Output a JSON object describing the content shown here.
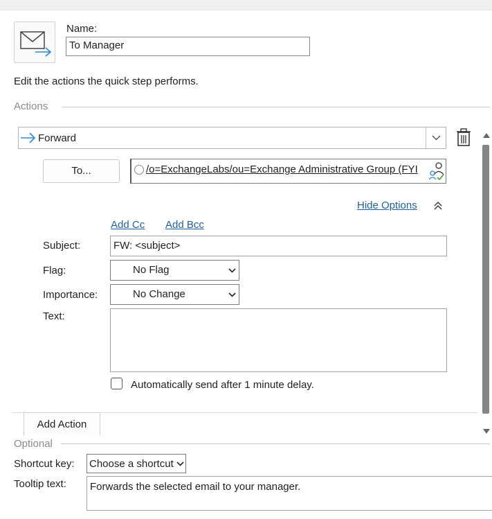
{
  "name": {
    "label": "Name:",
    "value": "To Manager"
  },
  "instructions": "Edit the actions the quick step performs.",
  "actions": {
    "section_label": "Actions",
    "action_select": {
      "value": "Forward",
      "icon": "arrow-right-icon"
    },
    "to_button": "To...",
    "to_value": "/o=ExchangeLabs/ou=Exchange Administrative Group (FYI",
    "hide_options": "Hide Options",
    "add_cc": "Add Cc",
    "add_bcc": "Add Bcc",
    "subject": {
      "label": "Subject:",
      "value": "FW: <subject>"
    },
    "flag": {
      "label": "Flag:",
      "value": "No Flag"
    },
    "importance": {
      "label": "Importance:",
      "value": "No Change"
    },
    "text": {
      "label": "Text:",
      "value": ""
    },
    "auto_send": {
      "label": "Automatically send after 1 minute delay.",
      "checked": false
    },
    "add_action": "Add Action"
  },
  "optional": {
    "section_label": "Optional",
    "shortcut": {
      "label": "Shortcut key:",
      "value": "Choose a shortcut"
    },
    "tooltip": {
      "label": "Tooltip text:",
      "value": "Forwards the selected email to your manager."
    }
  },
  "colors": {
    "accent": "#1f5fa6",
    "arrow": "#2b88d8"
  }
}
